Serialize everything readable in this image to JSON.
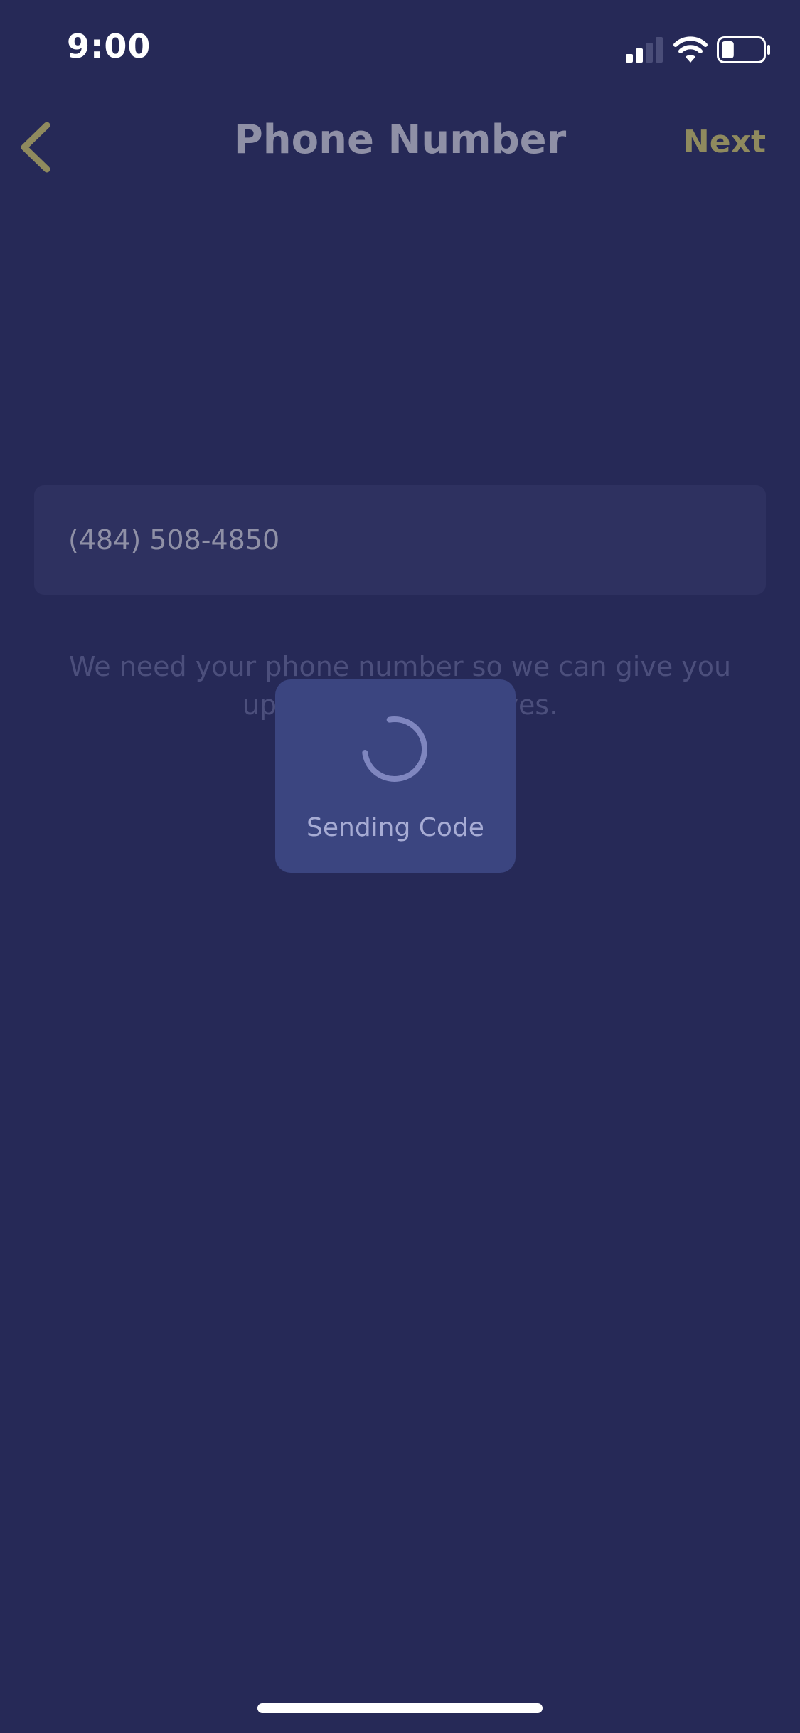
{
  "status_bar": {
    "time": "9:00",
    "icons": [
      "signal-icon",
      "wifi-icon",
      "battery-icon"
    ],
    "battery_level": 0.3
  },
  "nav": {
    "back_icon": "chevron-left-icon",
    "title": "Phone Number",
    "next_label": "Next"
  },
  "form": {
    "phone_value": "(484) 508-4850",
    "helper_text": "We need your phone number so we can give you updates on your saves."
  },
  "hud": {
    "label": "Sending Code",
    "icon": "spinner-icon"
  },
  "colors": {
    "background": "#262957",
    "accent": "#8f8a5e",
    "hud_background": "#3b4580",
    "field_background": "#2e3160"
  }
}
